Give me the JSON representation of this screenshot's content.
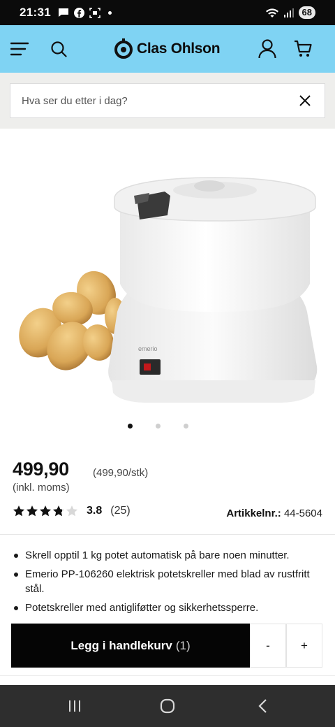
{
  "status_bar": {
    "time": "21:31",
    "battery": "68"
  },
  "header": {
    "logo_text": "Clas Ohlson",
    "accent_color": "#7fd3f3"
  },
  "search": {
    "placeholder": "Hva ser du etter i dag?"
  },
  "product": {
    "price": "499,90",
    "unit_price": "(499,90/stk)",
    "vat_note": "(inkl. moms)",
    "rating_value": "3.8",
    "rating_fraction": 0.76,
    "rating_count": "(25)",
    "article_label": "Artikkelnr.:",
    "article_number": "44-5604",
    "image_brand_text": "emerio",
    "gallery_dots": 3,
    "gallery_active_index": 0,
    "bullets": [
      "Skrell opptil 1 kg potet automatisk på bare noen minutter.",
      "Emerio PP-106260 elektrisk potetskreller med blad av rustfritt stål.",
      "Potetskreller med antigliføtter og sikkerhetssperre."
    ]
  },
  "cart": {
    "add_label": "Legg i handlekurv",
    "quantity": "(1)",
    "minus": "-",
    "plus": "+"
  }
}
